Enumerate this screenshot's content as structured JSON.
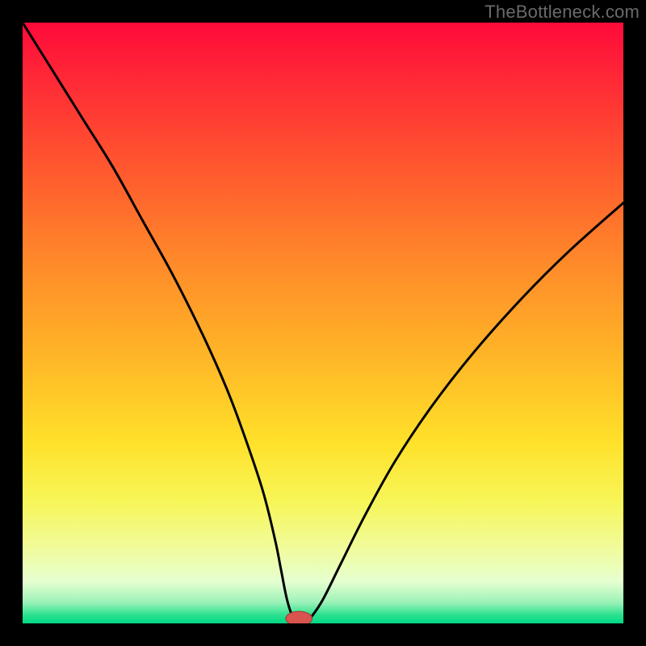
{
  "watermark": "TheBottleneck.com",
  "colors": {
    "background": "#000000",
    "curve": "#000000",
    "marker_fill": "#d9534f",
    "gradient_stops": [
      {
        "offset": 0.0,
        "color": "#ff0a3a"
      },
      {
        "offset": 0.1,
        "color": "#ff2b36"
      },
      {
        "offset": 0.25,
        "color": "#ff5a2e"
      },
      {
        "offset": 0.4,
        "color": "#ff8a2a"
      },
      {
        "offset": 0.55,
        "color": "#ffb427"
      },
      {
        "offset": 0.7,
        "color": "#ffe12a"
      },
      {
        "offset": 0.8,
        "color": "#f7f65a"
      },
      {
        "offset": 0.88,
        "color": "#f0fca0"
      },
      {
        "offset": 0.93,
        "color": "#e6ffd0"
      },
      {
        "offset": 0.965,
        "color": "#9cf2b8"
      },
      {
        "offset": 0.985,
        "color": "#2fe290"
      },
      {
        "offset": 1.0,
        "color": "#00d884"
      }
    ]
  },
  "chart_data": {
    "type": "line",
    "title": "",
    "xlabel": "",
    "ylabel": "",
    "xlim": [
      0,
      100
    ],
    "ylim": [
      0,
      100
    ],
    "grid": false,
    "legend": false,
    "series": [
      {
        "name": "bottleneck-curve",
        "x": [
          0,
          5,
          10,
          15,
          20,
          25,
          30,
          34,
          37,
          40,
          42,
          43,
          44,
          45,
          46,
          47,
          48,
          50,
          53,
          57,
          62,
          68,
          75,
          83,
          91,
          100
        ],
        "y": [
          100,
          92,
          84,
          76,
          67,
          58,
          48,
          39,
          31,
          22,
          14,
          9,
          4,
          1,
          0,
          0,
          1,
          4,
          10,
          18,
          27,
          36,
          45,
          54,
          62,
          70
        ]
      }
    ],
    "marker": {
      "x": 46,
      "y": 0,
      "rx": 2.2,
      "ry": 1.2
    },
    "notes": "V-shaped bottleneck curve; minimum ≈ x=46. Axes unlabeled; background is a red→yellow→green vertical gradient."
  }
}
